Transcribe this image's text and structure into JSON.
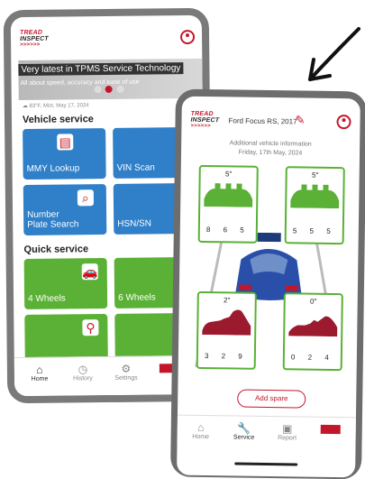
{
  "phone_left": {
    "logo": {
      "line1": "TREAD",
      "line2": "INSPECT",
      "arrows": ">>>>>>"
    },
    "banner": {
      "title": "Very latest in TPMS Service Technology",
      "subtitle": "All about speed, accuracy and ease of use",
      "weather": "83°F, Mist, May 17, 2024"
    },
    "vehicle_service": {
      "heading": "Vehicle service",
      "tiles": [
        {
          "label": "MMY Lookup",
          "icon": "clipboard-icon"
        },
        {
          "label": "VIN Scan",
          "icon": "barcode-icon"
        },
        {
          "label": "Number Plate Search",
          "icon": "search-icon"
        },
        {
          "label": "HSN/SN",
          "icon": "document-icon"
        }
      ]
    },
    "quick_service": {
      "heading": "Quick service",
      "tiles": [
        {
          "label": "4 Wheels",
          "icon": "car-icon"
        },
        {
          "label": "6 Wheels",
          "icon": "truck-icon"
        },
        {
          "label": "",
          "icon": "motorcycle-icon"
        },
        {
          "label": "",
          "icon": "tyre-icon"
        }
      ]
    },
    "nav": [
      {
        "label": "Home",
        "icon": "home-icon"
      },
      {
        "label": "History",
        "icon": "history-icon"
      },
      {
        "label": "Settings",
        "icon": "gear-icon"
      },
      {
        "label": "",
        "icon": "brand-icon"
      }
    ]
  },
  "phone_right": {
    "logo": {
      "line1": "TREAD",
      "line2": "INSPECT",
      "arrows": ">>>>>>"
    },
    "vehicle_name": "Ford Focus RS, 2017",
    "info_line1": "Additional vehicle information",
    "info_line2": "Friday, 17th May, 2024",
    "tyres": [
      {
        "position": "front-left",
        "depth": "5\"",
        "values": "8 6 5",
        "status": "good"
      },
      {
        "position": "front-right",
        "depth": "5\"",
        "values": "5 5 5",
        "status": "good"
      },
      {
        "position": "rear-left",
        "depth": "2\"",
        "values": "3 2 9",
        "status": "worn"
      },
      {
        "position": "rear-right",
        "depth": "0\"",
        "values": "0 2 4",
        "status": "worn"
      }
    ],
    "add_spare_label": "Add spare",
    "nav": [
      {
        "label": "Home",
        "icon": "home-icon"
      },
      {
        "label": "Service",
        "icon": "wrench-icon"
      },
      {
        "label": "Report",
        "icon": "report-icon"
      },
      {
        "label": "",
        "icon": "brand-icon"
      }
    ]
  },
  "colors": {
    "accent": "#c4162a",
    "good": "#5ab135",
    "worn": "#9b1a2e",
    "blue": "#2f7fc9"
  }
}
